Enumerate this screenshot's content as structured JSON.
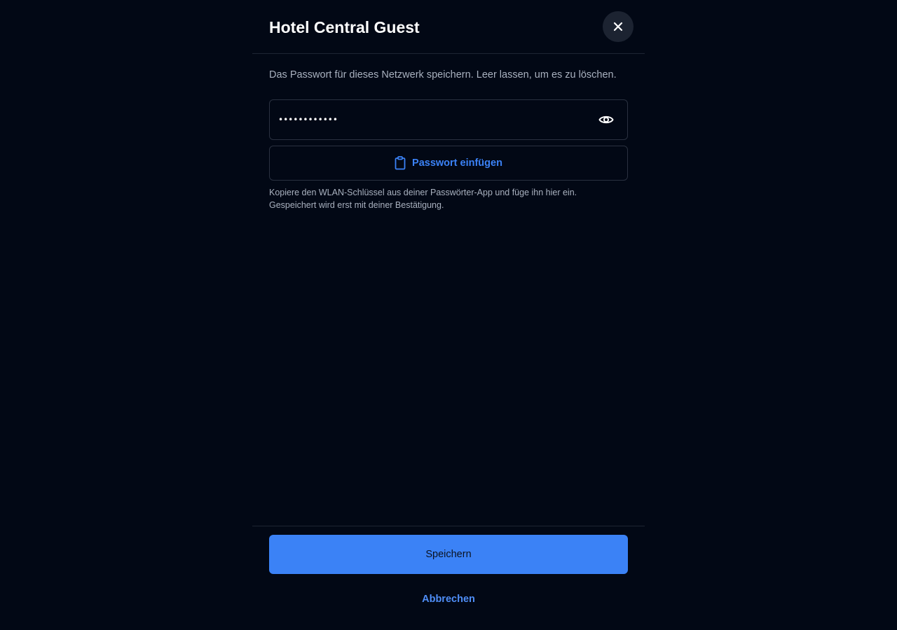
{
  "dialog": {
    "title": "Hotel Central Guest",
    "description": "Das Passwort für dieses Netzwerk speichern. Leer lassen, um es zu löschen.",
    "close_icon": "close-icon"
  },
  "password": {
    "masked_value": "••••••••••••",
    "visibility_icon": "eye-icon"
  },
  "paste": {
    "label": "Passwort einfügen",
    "icon": "clipboard-icon"
  },
  "hint": {
    "line1": "Kopiere den WLAN-Schlüssel aus deiner Passwörter-App und füge ihn hier ein.",
    "line2": "Gespeichert wird erst mit deiner Bestätigung."
  },
  "actions": {
    "save_label": "Speichern",
    "cancel_label": "Abbrechen"
  },
  "colors": {
    "background": "#020815",
    "accent": "#3b82f6",
    "border": "#2a3140",
    "muted_text": "#a9b1bf"
  }
}
